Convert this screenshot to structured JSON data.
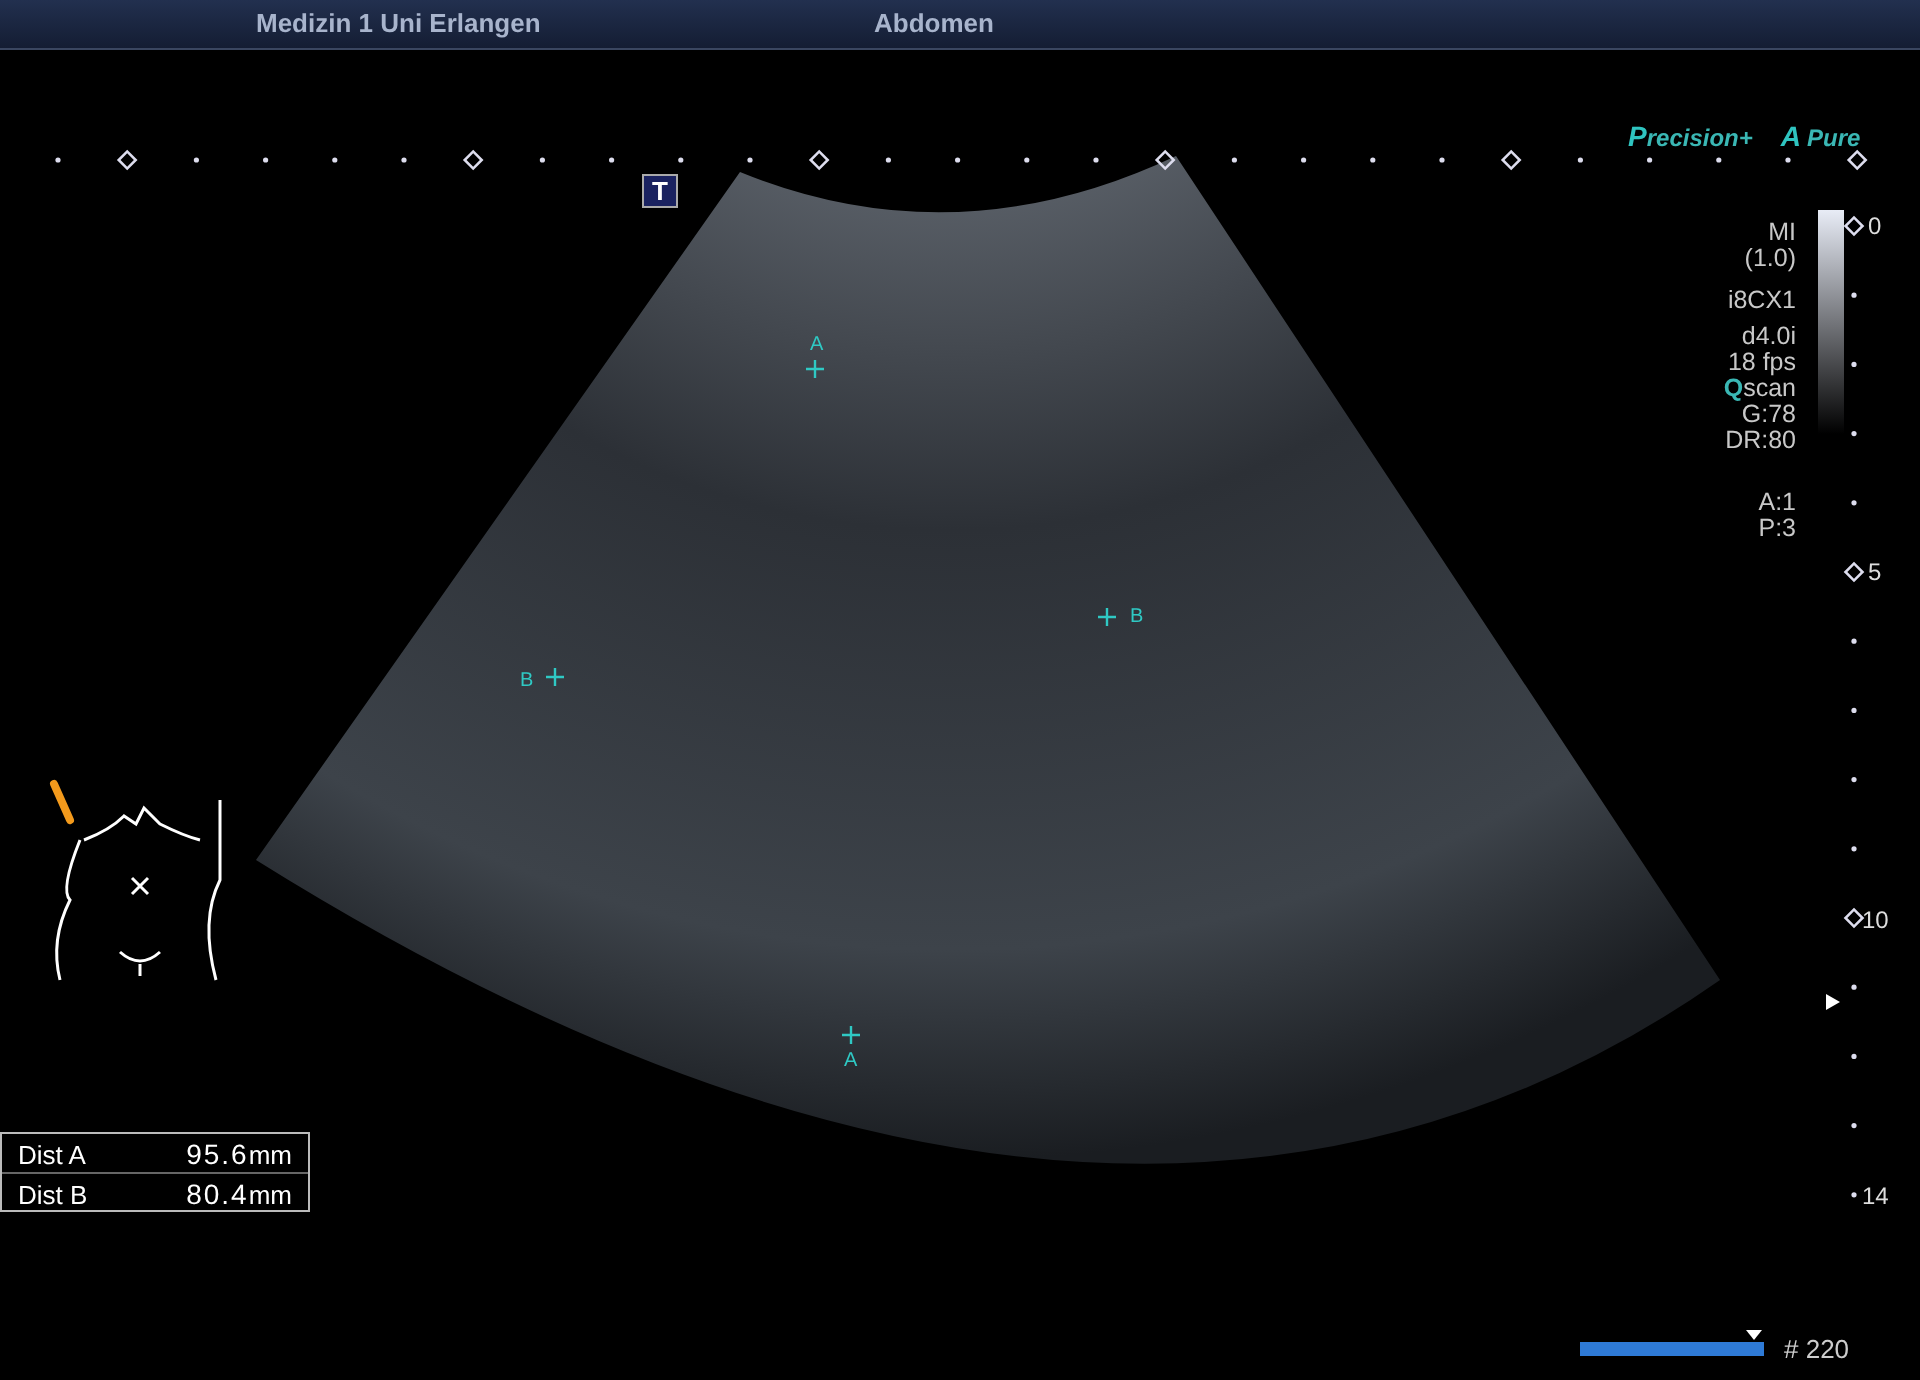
{
  "header": {
    "institution": "Medizin 1 Uni Erlangen",
    "exam": "Abdomen"
  },
  "logos": [
    {
      "accent": "P",
      "text": "recision+"
    },
    {
      "accent": "A",
      "text": "Pure"
    }
  ],
  "tgc_button": {
    "label": "T"
  },
  "parameters": [
    {
      "text": "MI"
    },
    {
      "text": "(1.0)"
    },
    {
      "text": "i8CX1"
    },
    {
      "text": "d4.0i"
    },
    {
      "text": "18 fps"
    },
    {
      "accent": "Q",
      "text": "scan"
    },
    {
      "text": "G:78"
    },
    {
      "text": "DR:80"
    },
    {
      "text": "A:1"
    },
    {
      "text": "P:3"
    }
  ],
  "depth_scale": [
    "0",
    "5",
    "10",
    "14"
  ],
  "calipers": [
    {
      "label": "A"
    },
    {
      "label": "B"
    },
    {
      "label": "B"
    },
    {
      "label": "A"
    }
  ],
  "measurements": [
    {
      "name": "Dist A",
      "value": "95.6",
      "unit": "mm"
    },
    {
      "name": "Dist B",
      "value": "80.4",
      "unit": "mm"
    }
  ],
  "cine_bar": {
    "level": 0.95,
    "frame": "# 220"
  }
}
